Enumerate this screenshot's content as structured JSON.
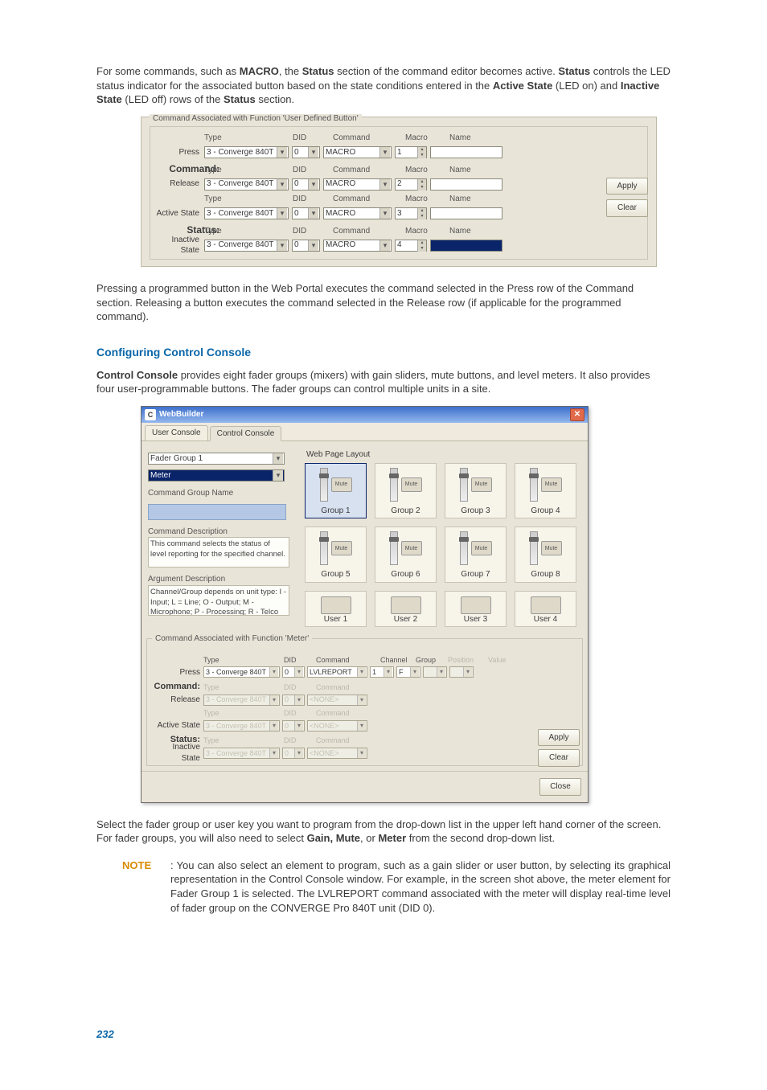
{
  "para1_a": "For some commands, such as ",
  "macro_b": "MACRO",
  "para1_b": ", the ",
  "status_b": "Status",
  "para1_c": " section of the command editor becomes active. ",
  "status_b2": "Status",
  "para1_d": " controls the LED status indicator for the associated button based on the state conditions entered in the ",
  "active_state_b": "Active State",
  "para1_e": " (LED on) and ",
  "inactive_state_b": "Inactive State",
  "para1_f": " (LED off) rows of the ",
  "status_b3": "Status",
  "para1_g": " section.",
  "fig1": {
    "fieldset": "Command Associated with Function 'User Defined Button'",
    "headers": [
      "Type",
      "DID",
      "Command",
      "Macro",
      "Name"
    ],
    "rows": {
      "press": {
        "lbl": "Press",
        "type": "3 - Converge 840T",
        "did": "0",
        "cmd": "MACRO",
        "macro": "1",
        "name": ""
      },
      "command_lbl": "Command:",
      "release": {
        "lbl": "Release",
        "type": "3 - Converge 840T",
        "did": "0",
        "cmd": "MACRO",
        "macro": "2",
        "name": ""
      },
      "active": {
        "lbl": "Active State",
        "type": "3 - Converge 840T",
        "did": "0",
        "cmd": "MACRO",
        "macro": "3",
        "name": ""
      },
      "status_lbl": "Status:",
      "inactive": {
        "lbl": "Inactive State",
        "type": "3 - Converge 840T",
        "did": "0",
        "cmd": "MACRO",
        "macro": "4",
        "name": ""
      }
    },
    "apply": "Apply",
    "clear": "Clear"
  },
  "para2": "Pressing a programmed button in the Web Portal executes the command selected in the Press row of the Command section. Releasing a button executes the command selected in the Release row (if applicable for the programmed command).",
  "heading": "Configuring Control Console",
  "para3_a": "Control Console",
  "para3_b": " provides eight fader groups (mixers) with gain sliders, mute buttons, and level meters. It also provides four user-programmable buttons. The fader groups can control multiple units in a site.",
  "win": {
    "title": "WebBuilder",
    "tabs": [
      "User Console",
      "Control Console"
    ],
    "fader_dd": "Fader Group 1",
    "meter_dd": "Meter",
    "cmd_group_name_lbl": "Command Group Name",
    "cmd_desc_lbl": "Command Description",
    "cmd_desc_txt": "This command selects the status of level reporting for the specified channel.",
    "arg_desc_lbl": "Argument Description",
    "arg_desc_txt": "Channel/Group depends on unit type: I - Input; L = Line; O - Output; M - Microphone; P - Processing; R - Telco Rx",
    "layout_lbl": "Web Page Layout",
    "groups": [
      "Group 1",
      "Group 2",
      "Group 3",
      "Group 4",
      "Group 5",
      "Group 6",
      "Group 7",
      "Group 8"
    ],
    "users": [
      "User 1",
      "User 2",
      "User 3",
      "User 4"
    ],
    "mute": "Mute",
    "cmd_fieldset": "Command Associated with Function 'Meter'",
    "headers_a": [
      "Type",
      "DID",
      "Command",
      "Channel",
      "Group",
      "Position",
      "Value"
    ],
    "headers_b": [
      "Type",
      "DID",
      "Command"
    ],
    "rows": {
      "press": {
        "lbl": "Press",
        "type": "3 - Converge 840T",
        "did": "0",
        "cmd": "LVLREPORT",
        "ch": "1",
        "grp": "F",
        "pos": "",
        "val": ""
      },
      "command_lbl": "Command:",
      "release": {
        "lbl": "Release",
        "type": "3 - Converge 840T",
        "did": "0",
        "cmd": "<NONE>"
      },
      "active": {
        "lbl": "Active State",
        "type": "3 - Converge 840T",
        "did": "0",
        "cmd": "<NONE>"
      },
      "status_lbl": "Status:",
      "inactive": {
        "lbl": "Inactive State",
        "type": "3 - Converge 840T",
        "did": "0",
        "cmd": "<NONE>"
      }
    },
    "apply": "Apply",
    "clear": "Clear",
    "close": "Close"
  },
  "para4_a": "Select the fader group or user key you want to program from the drop-down list in the upper left hand corner of the screen. For fader groups, you will also need to select ",
  "gmm_b": "Gain, Mute",
  "para4_b": ", or ",
  "meter_b": "Meter",
  "para4_c": " from the second drop-down list.",
  "note_lbl": "NOTE",
  "note_txt": ": You can also select an element to program, such as a gain slider or user button, by selecting its graphical representation in the Control Console window. For example, in the screen shot above, the meter element for Fader Group 1 is selected. The LVLREPORT command associated with the meter will display real-time level of fader group on the CONVERGE Pro 840T unit (DID 0).",
  "page": "232"
}
